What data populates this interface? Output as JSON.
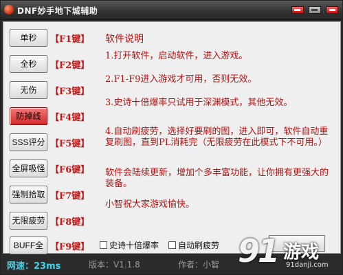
{
  "window": {
    "title": "DNF妙手地下城辅助"
  },
  "buttons": [
    {
      "label": "单秒",
      "hotkey": "【F1键】",
      "active": false
    },
    {
      "label": "全秒",
      "hotkey": "【F2键】",
      "active": false
    },
    {
      "label": "无伤",
      "hotkey": "【F3键】",
      "active": false
    },
    {
      "label": "防掉线",
      "hotkey": "【F4键】",
      "active": true
    },
    {
      "label": "SSS评分",
      "hotkey": "【F5键】",
      "active": false
    },
    {
      "label": "全屏吸怪",
      "hotkey": "【F6键】",
      "active": false
    },
    {
      "label": "强制拾取",
      "hotkey": "【F7键】",
      "active": false
    },
    {
      "label": "无限疲劳",
      "hotkey": "【F8键】",
      "active": false
    },
    {
      "label": "BUFF全开",
      "hotkey": "【F9键】",
      "active": false
    }
  ],
  "info": {
    "title": "软件说明",
    "lines": [
      "1.打开软件，启动软件，进入游戏。",
      "2.F1-F9进入游戏才可用，否则无效。",
      "3.史诗十倍爆率只试用于深渊模式，其他无效。",
      "4.自动刷疲劳，选择好要刷的图，进入即可，软件自动重复刷图，直到PL消耗完（无限疲劳在此模式下不可用。）",
      "软件会陆续更新，增加个多丰富功能，让你拥有更强大的装备。",
      "小智祝大家游戏愉快。"
    ]
  },
  "checkboxes": [
    {
      "label": "史诗十倍爆率",
      "checked": false
    },
    {
      "label": "自动刷疲劳",
      "checked": false
    }
  ],
  "status": {
    "speed": "网速：23ms",
    "version": "版本：V1.1.8",
    "author": "作者：小智"
  },
  "watermark": {
    "number": "91",
    "text": "游戏",
    "site": "91danji.com"
  },
  "colors": {
    "accent_red": "#b01414",
    "active_button": "#d42a2a",
    "speed_text": "#3ed4e8"
  }
}
